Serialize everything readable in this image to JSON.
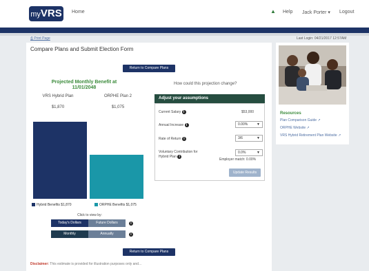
{
  "header": {
    "logo_small": "my",
    "logo_big": "VRS",
    "home": "Home",
    "help": "Help",
    "user": "Jack Porter",
    "logout": "Logout",
    "print_page": "Print Page",
    "last_login": "Last Login: 04/21/2017 12:57AM"
  },
  "main": {
    "title": "Compare Plans and Submit Election Form",
    "return_button": "Return to Compare Plans",
    "projection_title": "Projected Monthly Benefit at 11/01/2048",
    "vrs_label": "VRS Hybrid Plan",
    "vrs_value": "$1,870",
    "orphe_label": "ORPHE Plan 2",
    "orphe_value": "$1,075",
    "legend_hybrid": "Hybrid Benefits $1,870",
    "legend_orphe": "ORPHE Benefits $1,075",
    "click_to_view": "Click to view by:",
    "todays_dollars": "Today's Dollars",
    "future_dollars": "Future Dollars",
    "monthly": "Monthly",
    "annually": "Annually",
    "question": "How could this projection change?",
    "disclaimer_label": "Disclaimer:",
    "disclaimer_text": "This estimate is provided for illustration purposes only and..."
  },
  "assumptions": {
    "header": "Adjust your assumptions",
    "salary_label": "Current Salary",
    "salary_value": "$53,000",
    "increase_label": "Annual Increase",
    "increase_value": "0.00%",
    "return_label": "Rate of Return",
    "return_value": "3/6",
    "voluntary_label": "Voluntary Contribution for Hybrid Plan",
    "voluntary_value": "0.0%",
    "employer_match": "Employer match: 0.00%",
    "update_button": "Update Results"
  },
  "sidebar": {
    "resources_title": "Resources",
    "link1": "Plan Comparison Guide",
    "link2": "ORPHE Website",
    "link3": "VRS Hybrid Retirement Plan Website"
  },
  "chart_data": {
    "type": "bar",
    "categories": [
      "VRS Hybrid Plan",
      "ORPHE Plan 2"
    ],
    "values": [
      1870,
      1075
    ],
    "ylim": [
      0,
      1870
    ],
    "colors": [
      "#1d3366",
      "#1a97a8"
    ],
    "grid": false
  }
}
